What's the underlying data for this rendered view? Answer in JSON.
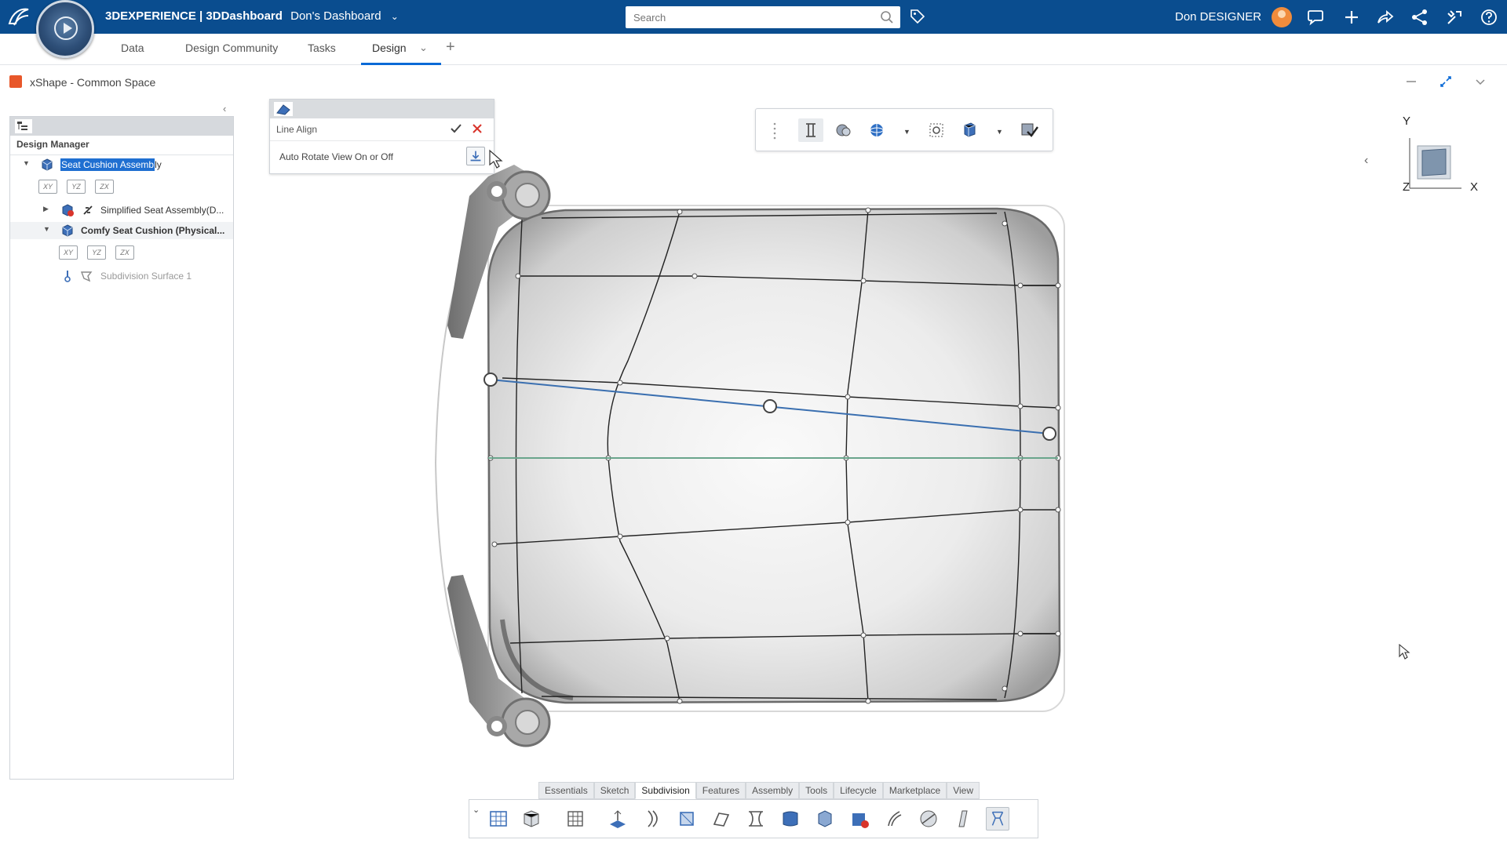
{
  "topbar": {
    "brand_strong": "3DEXPERIENCE | 3DDashboard",
    "dashboard_name": "Don's Dashboard",
    "search_placeholder": "Search",
    "user_name": "Don DESIGNER"
  },
  "tabs": [
    {
      "label": "Data"
    },
    {
      "label": "Design Community"
    },
    {
      "label": "Tasks"
    },
    {
      "label": "Design",
      "active": true
    }
  ],
  "app": {
    "title": "xShape - Common Space"
  },
  "design_manager": {
    "title": "Design Manager",
    "tree": {
      "root_label_selected": "Seat Cushion Assemb",
      "root_label_rest": "ly",
      "planes": [
        "XY",
        "YZ",
        "ZX"
      ],
      "child1_label": "Simplified Seat Assembly(D...",
      "child2_label": "Comfy Seat Cushion (Physical...",
      "child2_planes": [
        "XY",
        "YZ",
        "ZX"
      ],
      "child2_leaf_label": "Subdivision Surface 1"
    }
  },
  "line_align": {
    "title": "Line Align",
    "option_label": "Auto Rotate View On or Off"
  },
  "orientation": {
    "axis_y": "Y",
    "axis_z": "Z",
    "axis_x": "X"
  },
  "action_bar": {
    "tabs": [
      {
        "label": "Essentials"
      },
      {
        "label": "Sketch"
      },
      {
        "label": "Subdivision",
        "active": true
      },
      {
        "label": "Features"
      },
      {
        "label": "Assembly"
      },
      {
        "label": "Tools"
      },
      {
        "label": "Lifecycle"
      },
      {
        "label": "Marketplace"
      },
      {
        "label": "View"
      }
    ]
  },
  "colors": {
    "topbar": "#0a4d8f",
    "accent": "#0a6ad6",
    "selection": "#1f6fd1",
    "line_align_blue": "#3a6fb0",
    "symmetry_green": "#6aa58c",
    "cancel_red": "#d9342b"
  }
}
